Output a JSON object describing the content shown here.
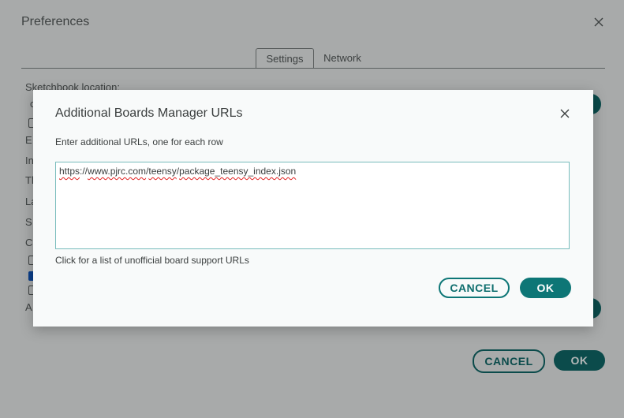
{
  "preferences": {
    "title": "Preferences",
    "tabs": [
      {
        "label": "Settings",
        "active": true
      },
      {
        "label": "Network",
        "active": false
      }
    ],
    "visible_labels": {
      "sketchbook": "Sketchbook location:",
      "row_c": "c",
      "row_e": "E",
      "row_in": "In",
      "row_th": "Th",
      "row_la": "La",
      "row_s": "S",
      "row_c2": "C",
      "row_a": "A"
    },
    "cancel_label": "CANCEL",
    "ok_label": "OK"
  },
  "dialog": {
    "title": "Additional Boards Manager URLs",
    "description": "Enter additional URLs, one for each row",
    "urls": [
      {
        "part1": "https",
        "part2": "://",
        "part3": "www.pjrc.com",
        "part4": "/",
        "part5": "teensy",
        "part6": "/",
        "part7": "package_teensy_index.json"
      }
    ],
    "link_text": "Click for a list of unofficial board support URLs",
    "cancel_label": "CANCEL",
    "ok_label": "OK"
  },
  "colors": {
    "accent": "#0d7676",
    "overlay": "#a8aaaa",
    "checkbox_checked": "#0b3f8a",
    "spellcheck": "#e02020"
  }
}
